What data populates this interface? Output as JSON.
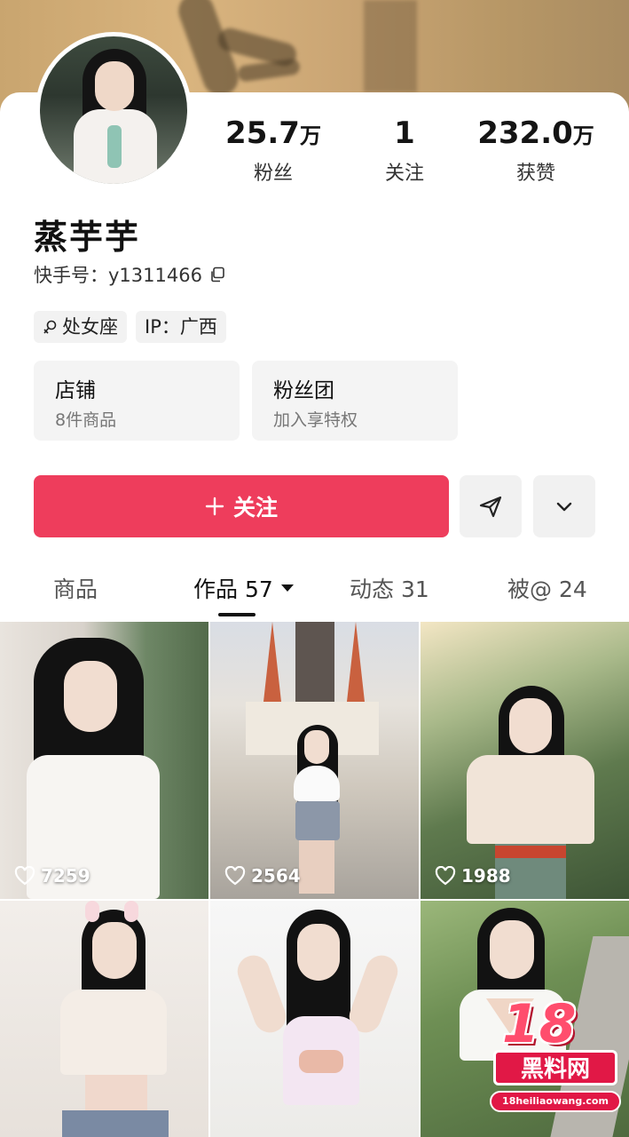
{
  "profile": {
    "name": "蒸芋芋",
    "uid_label": "快手号：",
    "uid_value": "y1311466"
  },
  "stats": [
    {
      "num": "25.7",
      "unit": "万",
      "label": "粉丝"
    },
    {
      "num": "1",
      "unit": "",
      "label": "关注"
    },
    {
      "num": "232.0",
      "unit": "万",
      "label": "获赞"
    }
  ],
  "tags": [
    {
      "icon": "virgo-icon",
      "label": "处女座"
    },
    {
      "label": "IP：广西"
    }
  ],
  "entries": [
    {
      "title": "店铺",
      "subtitle": "8件商品"
    },
    {
      "title": "粉丝团",
      "subtitle": "加入享特权"
    }
  ],
  "actions": {
    "follow_label": "关注",
    "follow_icon": "plus-icon",
    "share_icon": "send-icon",
    "more_icon": "chevron-down-icon",
    "accent_color": "#ee3d5c"
  },
  "tabs": [
    {
      "label": "商品"
    },
    {
      "label": "作品 57",
      "active": true
    },
    {
      "label": "动态 31"
    },
    {
      "label": "被@ 24"
    }
  ],
  "videos": [
    {
      "likes": "7259"
    },
    {
      "likes": "2564"
    },
    {
      "likes": "1988"
    },
    {
      "likes": ""
    },
    {
      "likes": ""
    },
    {
      "likes": ""
    }
  ],
  "watermark": {
    "number": "18",
    "name": "黑料网",
    "url": "18heiliaowang.com"
  }
}
